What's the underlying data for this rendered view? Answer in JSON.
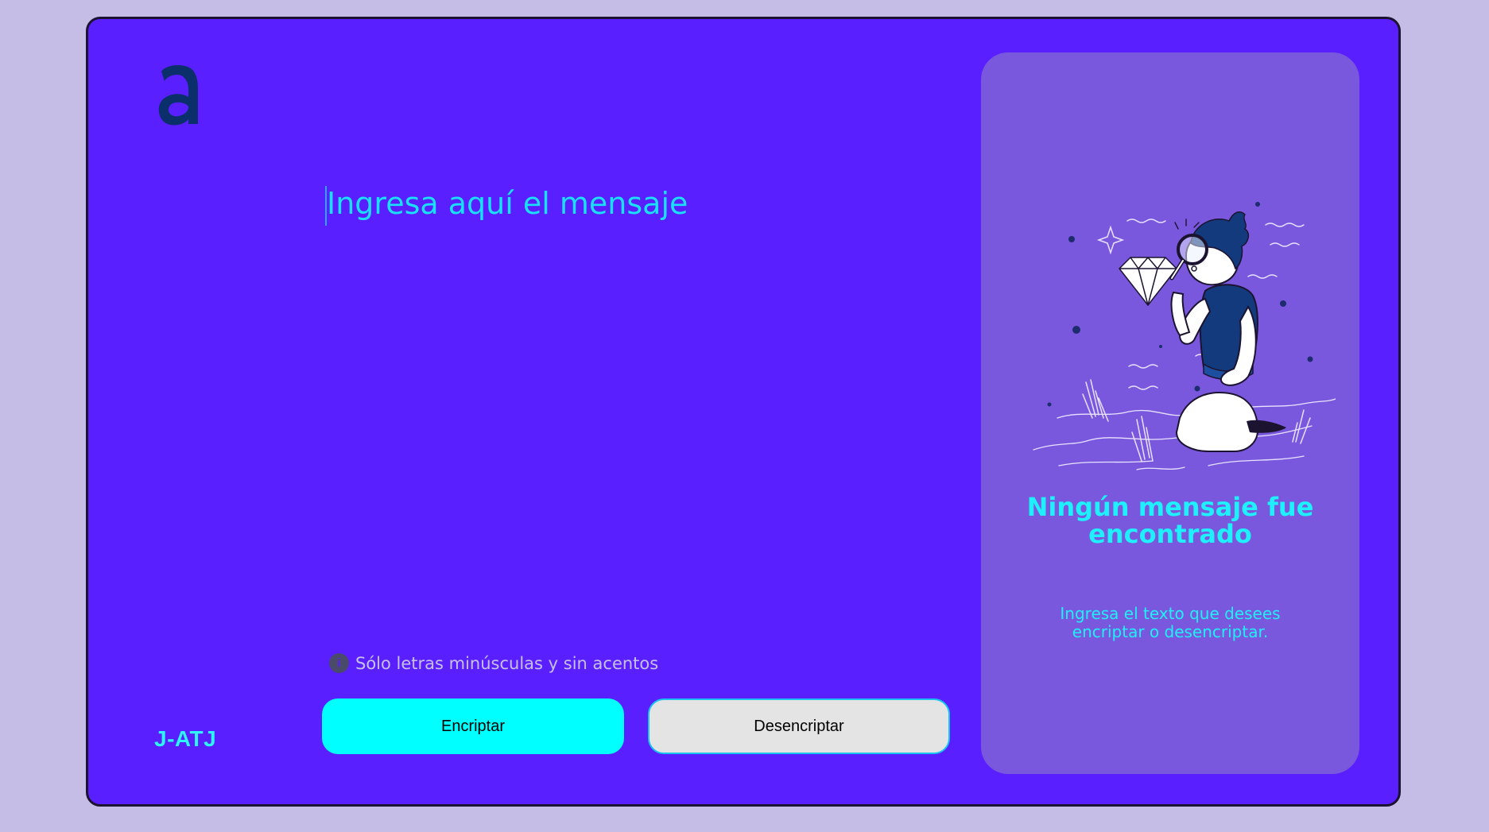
{
  "app": {
    "brand": "J-ATJ",
    "logo_icon": "letter-a-logo-icon"
  },
  "editor": {
    "placeholder": "Ingresa aquí el mensaje",
    "value": ""
  },
  "hint": {
    "icon": "info-icon",
    "text": "Sólo letras minúsculas y sin acentos"
  },
  "actions": {
    "encrypt_label": "Encriptar",
    "decrypt_label": "Desencriptar"
  },
  "output_panel": {
    "illustration": "person-with-magnifying-glass-and-diamond",
    "title": "Ningún mensaje fue encontrado",
    "subtitle": "Ingresa el texto que desees encriptar o desencriptar."
  },
  "colors": {
    "page_background": "#c5bde6",
    "app_background": "#5a1fff",
    "panel_background": "#7a58dd",
    "accent_cyan": "#00ffff",
    "text_cyan": "#1ff0ff",
    "secondary_button": "#e4e4e4",
    "logo_navy": "#0b2f6b"
  }
}
